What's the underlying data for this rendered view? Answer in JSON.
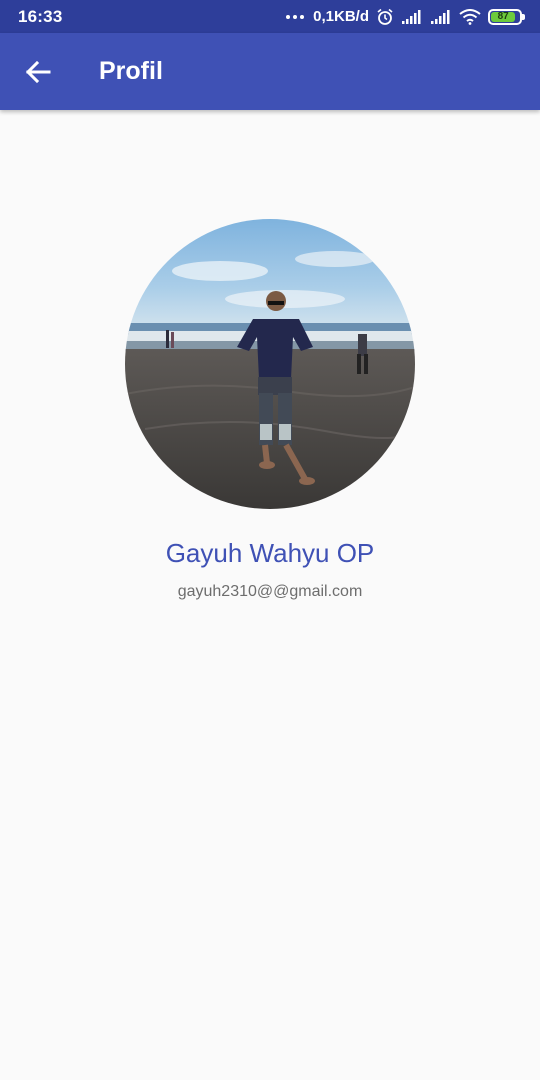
{
  "status_bar": {
    "time": "16:33",
    "network_speed": "0,1KB/d",
    "battery_level": "87",
    "icons": [
      "alarm-icon",
      "signal-icon",
      "signal-icon",
      "wifi-icon",
      "battery-icon"
    ]
  },
  "app_bar": {
    "title": "Profil",
    "back_icon": "arrow-left-icon",
    "color": "#3f51b5"
  },
  "profile": {
    "name": "Gayuh Wahyu OP",
    "email": "gayuh2310@@gmail.com",
    "name_color": "#3f51b5"
  }
}
